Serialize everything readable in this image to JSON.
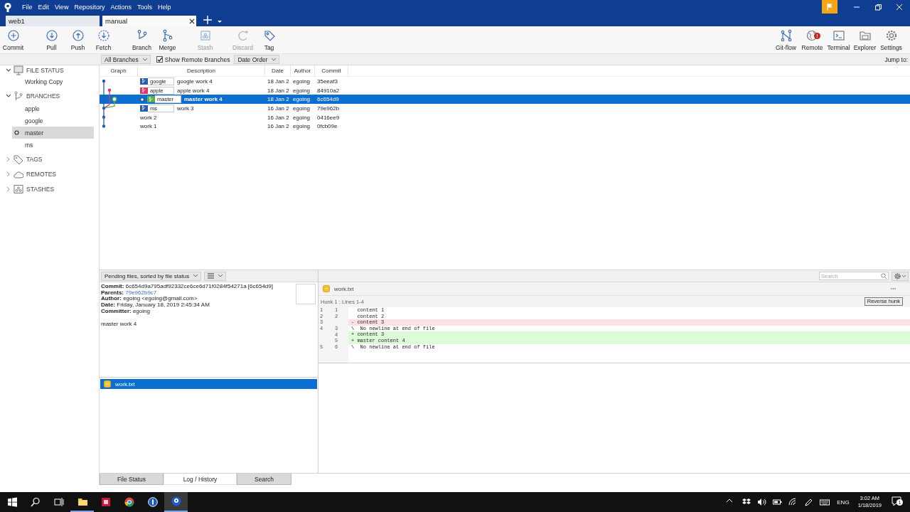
{
  "menu": [
    "File",
    "Edit",
    "View",
    "Repository",
    "Actions",
    "Tools",
    "Help"
  ],
  "repo_tabs": [
    {
      "label": "web1",
      "selected": false
    },
    {
      "label": "manual",
      "selected": true
    }
  ],
  "toolbar": [
    {
      "label": "Commit",
      "disabled": false
    },
    {
      "label": "Pull",
      "disabled": false
    },
    {
      "label": "Push",
      "disabled": false
    },
    {
      "label": "Fetch",
      "disabled": false
    },
    {
      "label": "Branch",
      "disabled": false
    },
    {
      "label": "Merge",
      "disabled": false
    },
    {
      "label": "Stash",
      "disabled": true
    },
    {
      "label": "Discard",
      "disabled": true
    },
    {
      "label": "Tag",
      "disabled": false
    }
  ],
  "toolbar_right": [
    {
      "label": "Git-flow"
    },
    {
      "label": "Remote",
      "badge": "!"
    },
    {
      "label": "Terminal"
    },
    {
      "label": "Explorer"
    },
    {
      "label": "Settings"
    }
  ],
  "filter_bar": {
    "branches": "All Branches",
    "show_remote": {
      "label": "Show Remote Branches",
      "checked": true
    },
    "order": "Date Order",
    "jump_label": "Jump to:"
  },
  "sidebar": [
    {
      "label": "FILE STATUS",
      "expanded": true,
      "children": [
        {
          "label": "Working Copy",
          "selected": false,
          "current": false
        }
      ]
    },
    {
      "label": "BRANCHES",
      "expanded": true,
      "children": [
        {
          "label": "apple",
          "selected": false,
          "current": false
        },
        {
          "label": "google",
          "selected": false,
          "current": false
        },
        {
          "label": "master",
          "selected": true,
          "current": true
        },
        {
          "label": "ms",
          "selected": false,
          "current": false
        }
      ]
    },
    {
      "label": "TAGS",
      "expanded": false
    },
    {
      "label": "REMOTES",
      "expanded": false
    },
    {
      "label": "STASHES",
      "expanded": false
    }
  ],
  "log": {
    "columns": [
      "Graph",
      "Description",
      "Date",
      "Author",
      "Commit"
    ],
    "rows": [
      {
        "ref": {
          "label": "google",
          "color": "#2c5da6"
        },
        "description": "google work 4",
        "date": "18 Jan 2",
        "author": "egoing",
        "commit": "35eeaf3",
        "selected": false,
        "head": false
      },
      {
        "ref": {
          "label": "apple",
          "color": "#d93a6a"
        },
        "description": "apple work 4",
        "date": "18 Jan 2",
        "author": "egoing",
        "commit": "84910a2",
        "selected": false,
        "head": false
      },
      {
        "ref": {
          "label": "master",
          "color": "#5cb146"
        },
        "description": "master work 4",
        "date": "18 Jan 2",
        "author": "egoing",
        "commit": "6c654d9",
        "selected": true,
        "head": true
      },
      {
        "ref": {
          "label": "ms",
          "color": "#2c5da6"
        },
        "description": "work 3",
        "date": "16 Jan 2",
        "author": "egoing",
        "commit": "79e962b",
        "selected": false,
        "head": false
      },
      {
        "description": "work 2",
        "date": "16 Jan 2",
        "author": "egoing",
        "commit": "0416ee9",
        "selected": false,
        "head": false
      },
      {
        "description": "work 1",
        "date": "16 Jan 2",
        "author": "egoing",
        "commit": "0fcb09e",
        "selected": false,
        "head": false
      }
    ]
  },
  "details": {
    "file_filter": "Pending files, sorted by file status",
    "commit_info": [
      {
        "label": "Commit:",
        "value": "6c654d9a795adf92332ce6ce6d71f0284f54271a [6c654d9]",
        "kind": "text"
      },
      {
        "label": "Parents:",
        "value": "79e962b9c7",
        "kind": "link"
      },
      {
        "label": "Author:",
        "value": "egoing <egoing@gmail.com>",
        "kind": "text"
      },
      {
        "label": "Date:",
        "value": "Friday, January 18, 2019 2:45:34 AM",
        "kind": "text"
      },
      {
        "label": "Committer:",
        "value": "egoing",
        "kind": "text"
      }
    ],
    "message": "master work 4",
    "files": [
      {
        "name": "work.txt",
        "selected": true
      }
    ]
  },
  "diff": {
    "search_placeholder": "Search",
    "file": "work.txt",
    "hunk": "Hunk 1 : Lines 1-4",
    "reverse_button": "Reverse hunk",
    "lines": [
      {
        "old": "1",
        "new": "1",
        "kind": "context",
        "text": "  content 1"
      },
      {
        "old": "2",
        "new": "2",
        "kind": "context",
        "text": "  content 2"
      },
      {
        "old": "3",
        "kind": "removed",
        "text": "- content 3"
      },
      {
        "old": "4",
        "new": "3",
        "kind": "context",
        "text": "\\  No newline at end of file"
      },
      {
        "new": "4",
        "kind": "added",
        "text": "+ content 3"
      },
      {
        "new": "5",
        "kind": "added",
        "text": "+ master content 4"
      },
      {
        "old": "5",
        "new": "6",
        "kind": "context",
        "text": "\\  No newline at end of file"
      }
    ]
  },
  "bottom_tabs": [
    {
      "label": "File Status",
      "selected": false
    },
    {
      "label": "Log / History",
      "selected": true
    },
    {
      "label": "Search",
      "selected": false
    }
  ],
  "taskbar": {
    "language": "ENG",
    "time": "3:02 AM",
    "date": "1/18/2019",
    "notifications": "1"
  }
}
